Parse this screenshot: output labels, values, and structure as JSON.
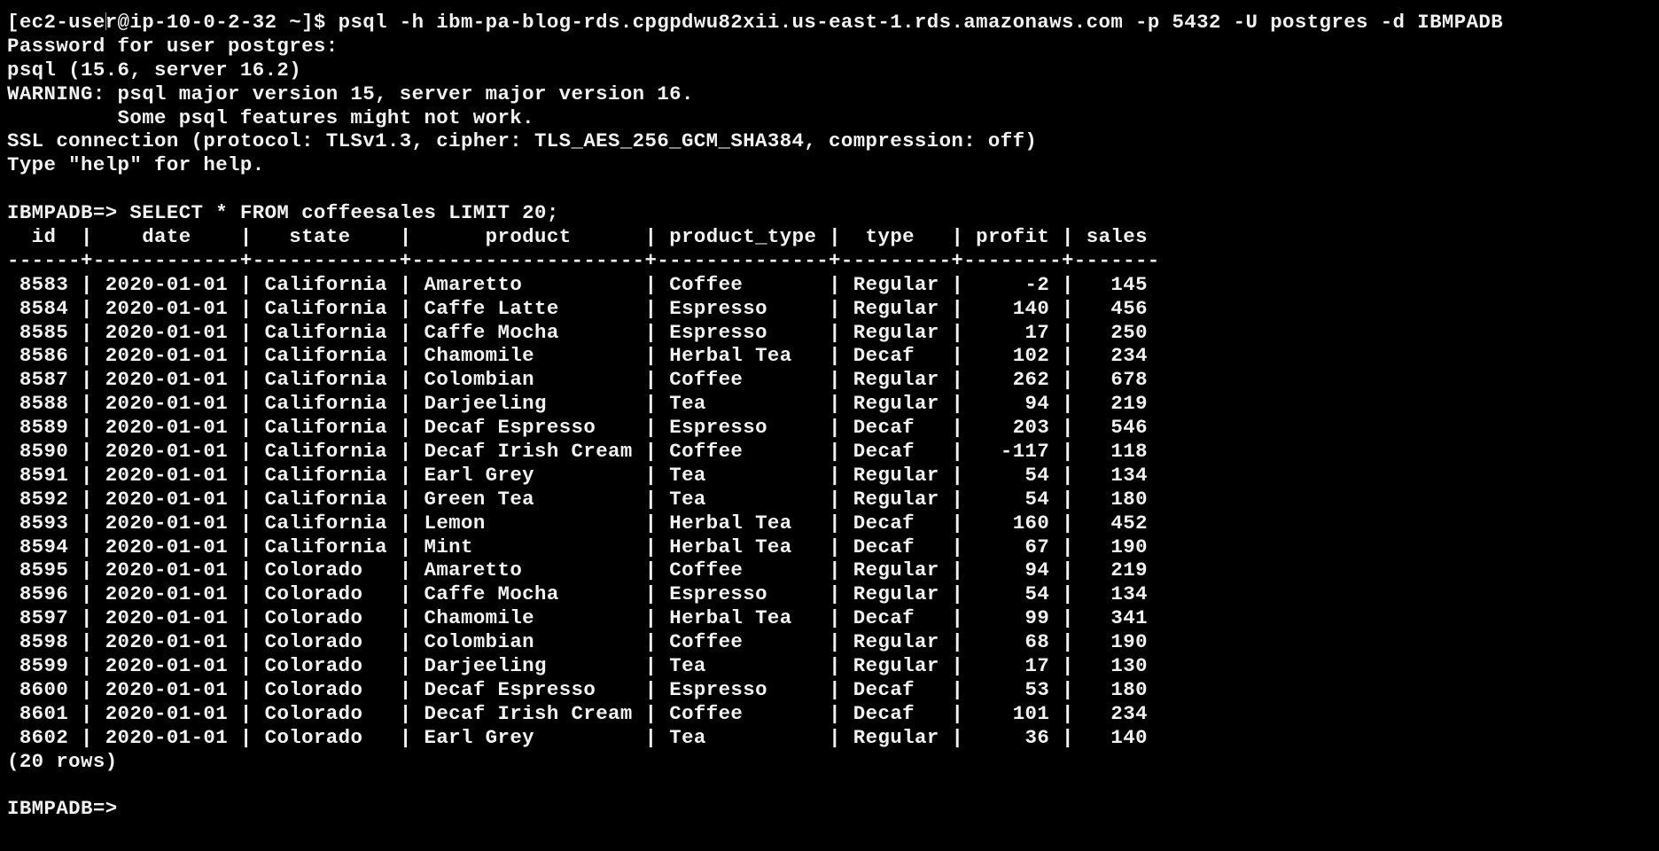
{
  "terminal": {
    "session_prompt": "[ec2-user@ip-10-0-2-32 ~]$ ",
    "connect_command": "psql -h ibm-pa-blog-rds.cpgpdwu82xii.us-east-1.rds.amazonaws.com -p 5432 -U postgres -d IBMPADB",
    "output_lines": [
      "Password for user postgres:",
      "psql (15.6, server 16.2)",
      "WARNING: psql major version 15, server major version 16.",
      "         Some psql features might not work.",
      "SSL connection (protocol: TLSv1.3, cipher: TLS_AES_256_GCM_SHA384, compression: off)",
      "Type \"help\" for help."
    ],
    "db_prompt": "IBMPADB=> ",
    "query": "SELECT * FROM coffeesales LIMIT 20;",
    "result": {
      "columns": [
        "id",
        "date",
        "state",
        "product",
        "product_type",
        "type",
        "profit",
        "sales"
      ],
      "rows": [
        [
          "8583",
          "2020-01-01",
          "California",
          "Amaretto",
          "Coffee",
          "Regular",
          "-2",
          "145"
        ],
        [
          "8584",
          "2020-01-01",
          "California",
          "Caffe Latte",
          "Espresso",
          "Regular",
          "140",
          "456"
        ],
        [
          "8585",
          "2020-01-01",
          "California",
          "Caffe Mocha",
          "Espresso",
          "Regular",
          "17",
          "250"
        ],
        [
          "8586",
          "2020-01-01",
          "California",
          "Chamomile",
          "Herbal Tea",
          "Decaf",
          "102",
          "234"
        ],
        [
          "8587",
          "2020-01-01",
          "California",
          "Colombian",
          "Coffee",
          "Regular",
          "262",
          "678"
        ],
        [
          "8588",
          "2020-01-01",
          "California",
          "Darjeeling",
          "Tea",
          "Regular",
          "94",
          "219"
        ],
        [
          "8589",
          "2020-01-01",
          "California",
          "Decaf Espresso",
          "Espresso",
          "Decaf",
          "203",
          "546"
        ],
        [
          "8590",
          "2020-01-01",
          "California",
          "Decaf Irish Cream",
          "Coffee",
          "Decaf",
          "-117",
          "118"
        ],
        [
          "8591",
          "2020-01-01",
          "California",
          "Earl Grey",
          "Tea",
          "Regular",
          "54",
          "134"
        ],
        [
          "8592",
          "2020-01-01",
          "California",
          "Green Tea",
          "Tea",
          "Regular",
          "54",
          "180"
        ],
        [
          "8593",
          "2020-01-01",
          "California",
          "Lemon",
          "Herbal Tea",
          "Decaf",
          "160",
          "452"
        ],
        [
          "8594",
          "2020-01-01",
          "California",
          "Mint",
          "Herbal Tea",
          "Decaf",
          "67",
          "190"
        ],
        [
          "8595",
          "2020-01-01",
          "Colorado",
          "Amaretto",
          "Coffee",
          "Regular",
          "94",
          "219"
        ],
        [
          "8596",
          "2020-01-01",
          "Colorado",
          "Caffe Mocha",
          "Espresso",
          "Regular",
          "54",
          "134"
        ],
        [
          "8597",
          "2020-01-01",
          "Colorado",
          "Chamomile",
          "Herbal Tea",
          "Decaf",
          "99",
          "341"
        ],
        [
          "8598",
          "2020-01-01",
          "Colorado",
          "Colombian",
          "Coffee",
          "Regular",
          "68",
          "190"
        ],
        [
          "8599",
          "2020-01-01",
          "Colorado",
          "Darjeeling",
          "Tea",
          "Regular",
          "17",
          "130"
        ],
        [
          "8600",
          "2020-01-01",
          "Colorado",
          "Decaf Espresso",
          "Espresso",
          "Decaf",
          "53",
          "180"
        ],
        [
          "8601",
          "2020-01-01",
          "Colorado",
          "Decaf Irish Cream",
          "Coffee",
          "Decaf",
          "101",
          "234"
        ],
        [
          "8602",
          "2020-01-01",
          "Colorado",
          "Earl Grey",
          "Tea",
          "Regular",
          "36",
          "140"
        ]
      ],
      "row_count_text": "(20 rows)"
    },
    "final_prompt": "IBMPADB=>"
  }
}
